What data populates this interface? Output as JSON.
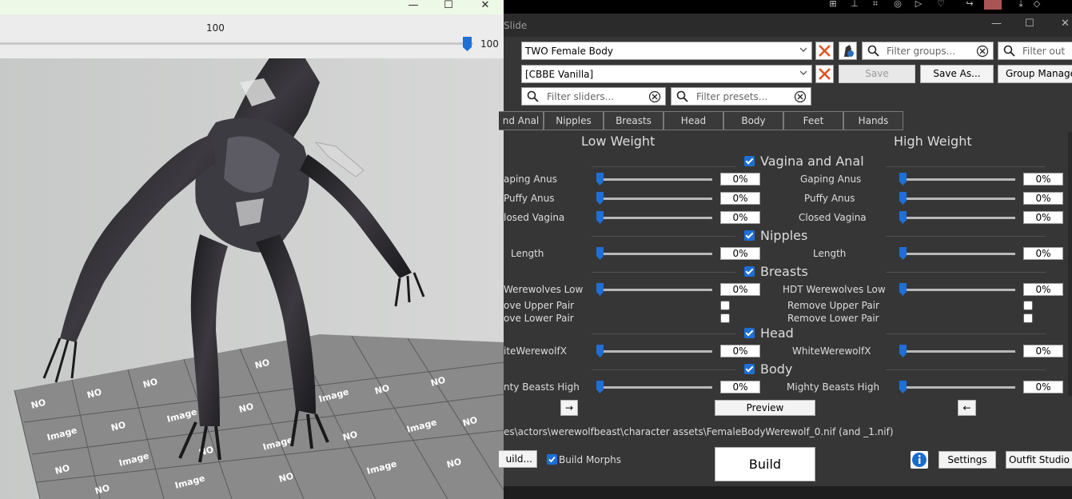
{
  "preview": {
    "slider_value": "100",
    "slider_max_label": "100",
    "no_image_text": "NO",
    "image_text": "Image"
  },
  "bodyslide": {
    "title": "Slide",
    "outfit_combo": "TWO Female Body",
    "preset_combo": "[CBBE Vanilla]",
    "filter_groups_placeholder": "Filter groups...",
    "filter_out_placeholder": "Filter out",
    "filter_sliders_placeholder": "Filter sliders...",
    "filter_presets_placeholder": "Filter presets...",
    "save_label": "Save",
    "save_as_label": "Save As...",
    "group_manager_label": "Group Manager",
    "tabs": [
      "nd Anal",
      "Nipples",
      "Breasts",
      "Head",
      "Body",
      "Feet",
      "Hands"
    ],
    "low_weight_header": "Low Weight",
    "high_weight_header": "High Weight",
    "groups": {
      "vagina": "Vagina and Anal",
      "nipples": "Nipples",
      "breasts": "Breasts",
      "head": "Head",
      "body": "Body"
    },
    "sliders": {
      "gaping_low": "aping Anus",
      "gaping_high": "Gaping Anus",
      "puffy_low": "Puffy Anus",
      "puffy_high": "Puffy Anus",
      "closed_low": "losed Vagina",
      "closed_high": "Closed Vagina",
      "length_low": "Length",
      "length_high": "Length",
      "hdt_low": "Werewolves Low",
      "hdt_high": "HDT Werewolves Low",
      "remove_upper_low": "ove Upper Pair",
      "remove_upper_high": "Remove Upper Pair",
      "remove_lower_low": "ove Lower Pair",
      "remove_lower_high": "Remove Lower Pair",
      "white_low": "iteWerewolfX",
      "white_high": "WhiteWerewolfX",
      "mighty_low": "nty Beasts High",
      "mighty_high": "Mighty Beasts High"
    },
    "value_percent": "0%",
    "copy_right_label": "→",
    "preview_label": "Preview",
    "copy_left_label": "←",
    "output_path": "es\\actors\\werewolfbeast\\character assets\\FemaleBodyWerewolf_0.nif (and _1.nif)",
    "batch_build_label": "uild...",
    "build_morphs_label": "Build Morphs",
    "build_label": "Build",
    "settings_label": "Settings",
    "outfit_studio_label": "Outfit Studio"
  },
  "colors": {
    "accent": "#1e6fd6",
    "panel_bg": "#363636",
    "clear_red": "#e05020"
  }
}
